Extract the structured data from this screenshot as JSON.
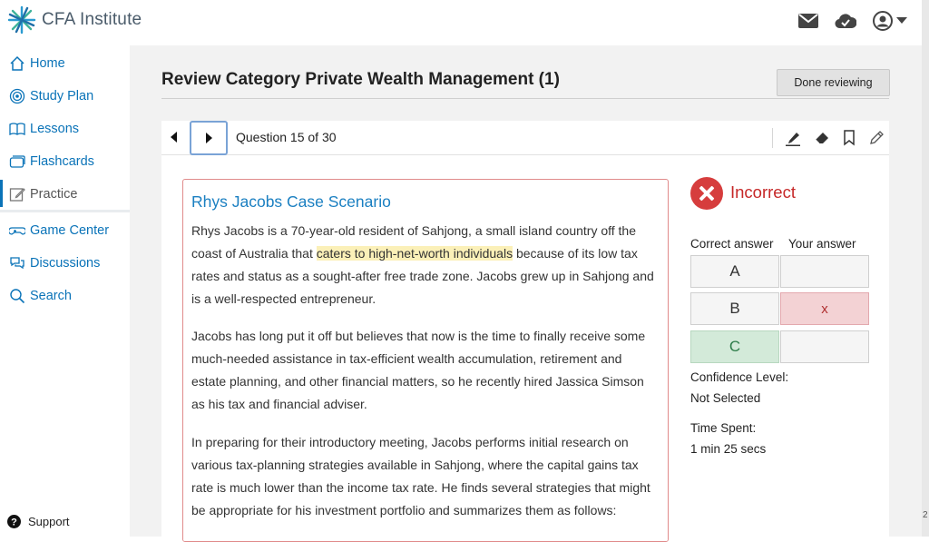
{
  "app": {
    "brand": "CFA Institute",
    "colors": {
      "link": "#0a73b8",
      "incorrect": "#d63d3d",
      "correct_cell": "#d3ead9",
      "wrong_cell": "#f3d2d4"
    }
  },
  "topbar": {
    "icons": [
      "mail-icon",
      "cloud-check-icon",
      "user-account-icon",
      "caret-down-icon"
    ]
  },
  "sidebar": {
    "items": [
      {
        "label": "Home",
        "icon": "home-icon"
      },
      {
        "label": "Study Plan",
        "icon": "target-icon"
      },
      {
        "label": "Lessons",
        "icon": "book-icon"
      },
      {
        "label": "Flashcards",
        "icon": "cards-icon"
      },
      {
        "label": "Practice",
        "icon": "edit-icon",
        "active": true
      },
      {
        "label": "Game Center",
        "icon": "gamepad-icon"
      },
      {
        "label": "Discussions",
        "icon": "chat-icon"
      },
      {
        "label": "Search",
        "icon": "search-icon"
      }
    ],
    "support": "Support"
  },
  "main": {
    "title": "Review Category Private Wealth Management (1)",
    "done_button": "Done reviewing",
    "question_counter": "Question 15 of 30",
    "tools": [
      "highlighter-icon",
      "eraser-icon",
      "bookmark-icon",
      "pencil-icon"
    ]
  },
  "case": {
    "title": "Rhys Jacobs Case Scenario",
    "p1_a": "Rhys Jacobs is a 70-year-old resident of Sahjong, a small island country off the coast of Australia that ",
    "p1_highlight": "caters to high-net-worth individuals",
    "p1_b": " because of its low tax rates and status as a sought-after free trade zone. Jacobs grew up in Sahjong and is a well-respected entrepreneur.",
    "p2": "Jacobs has long put it off but believes that now is the time to finally receive some much-needed assistance in tax-efficient wealth accumulation, retirement and estate planning, and other financial matters, so he recently hired Jassica Simson as his tax and financial adviser.",
    "p3": "In preparing for their introductory meeting, Jacobs performs initial research on various tax-planning strategies available in Sahjong, where the capital gains tax rate is much lower than the income tax rate. He finds several strategies that might be appropriate for his investment portfolio and summarizes them as follows:"
  },
  "result": {
    "status": "Incorrect",
    "correct_header": "Correct answer",
    "your_header": "Your answer",
    "rows": [
      {
        "option": "A",
        "your": ""
      },
      {
        "option": "B",
        "your": "x"
      },
      {
        "option": "C",
        "your": ""
      }
    ],
    "correct_option": "C",
    "selected_option": "B",
    "confidence_label": "Confidence Level:",
    "confidence_value": "Not Selected",
    "time_label": "Time Spent:",
    "time_value": "1 min 25 secs"
  },
  "edge": {
    "partial_text": "2"
  }
}
